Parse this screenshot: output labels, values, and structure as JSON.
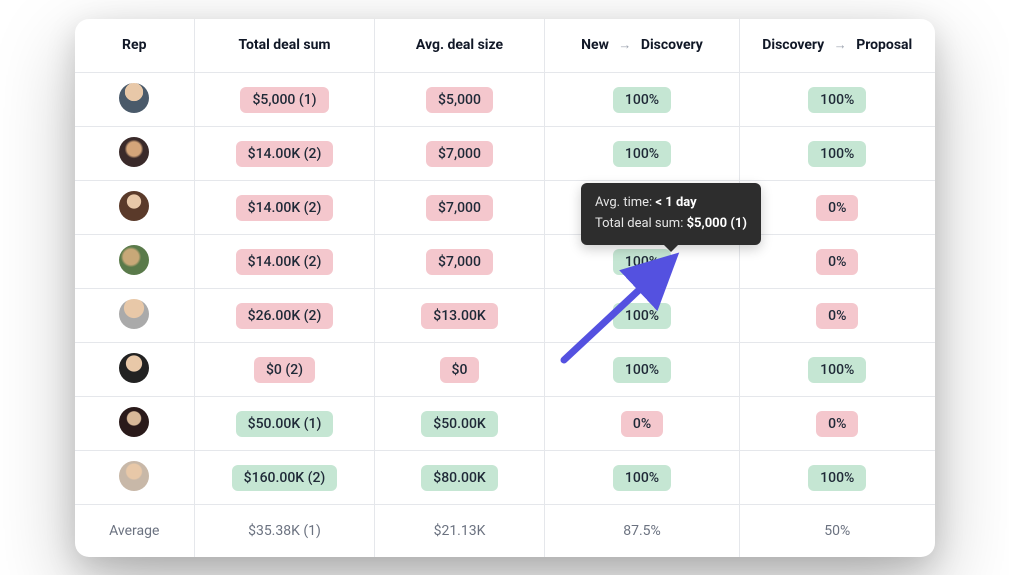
{
  "columns": {
    "rep": "Rep",
    "total_sum": "Total deal sum",
    "avg_size": "Avg. deal size",
    "stage1_from": "New",
    "stage1_to": "Discovery",
    "stage2_from": "Discovery",
    "stage2_to": "Proposal"
  },
  "rows": [
    {
      "total_sum": "$5,000 (1)",
      "total_sum_color": "red",
      "avg_size": "$5,000",
      "avg_size_color": "red",
      "stage1": "100%",
      "stage1_color": "green",
      "stage2": "100%",
      "stage2_color": "green"
    },
    {
      "total_sum": "$14.00K (2)",
      "total_sum_color": "red",
      "avg_size": "$7,000",
      "avg_size_color": "red",
      "stage1": "100%",
      "stage1_color": "green",
      "stage2": "100%",
      "stage2_color": "green"
    },
    {
      "total_sum": "$14.00K (2)",
      "total_sum_color": "red",
      "avg_size": "$7,000",
      "avg_size_color": "red",
      "stage1": "",
      "stage1_color": "hidden",
      "stage2": "0%",
      "stage2_color": "red"
    },
    {
      "total_sum": "$14.00K (2)",
      "total_sum_color": "red",
      "avg_size": "$7,000",
      "avg_size_color": "red",
      "stage1": "100%",
      "stage1_color": "green",
      "stage2": "0%",
      "stage2_color": "red"
    },
    {
      "total_sum": "$26.00K (2)",
      "total_sum_color": "red",
      "avg_size": "$13.00K",
      "avg_size_color": "red",
      "stage1": "100%",
      "stage1_color": "green",
      "stage2": "0%",
      "stage2_color": "red"
    },
    {
      "total_sum": "$0 (2)",
      "total_sum_color": "red",
      "avg_size": "$0",
      "avg_size_color": "red",
      "stage1": "100%",
      "stage1_color": "green",
      "stage2": "100%",
      "stage2_color": "green"
    },
    {
      "total_sum": "$50.00K (1)",
      "total_sum_color": "green",
      "avg_size": "$50.00K",
      "avg_size_color": "green",
      "stage1": "0%",
      "stage1_color": "red",
      "stage2": "0%",
      "stage2_color": "red"
    },
    {
      "total_sum": "$160.00K (2)",
      "total_sum_color": "green",
      "avg_size": "$80.00K",
      "avg_size_color": "green",
      "stage1": "100%",
      "stage1_color": "green",
      "stage2": "100%",
      "stage2_color": "green"
    }
  ],
  "footer": {
    "label": "Average",
    "total_sum": "$35.38K (1)",
    "avg_size": "$21.13K",
    "stage1": "87.5%",
    "stage2": "50%"
  },
  "tooltip": {
    "line1_label": "Avg. time: ",
    "line1_value": "< 1 day",
    "line2_label": "Total deal sum: ",
    "line2_value": "$5,000 (1)"
  }
}
